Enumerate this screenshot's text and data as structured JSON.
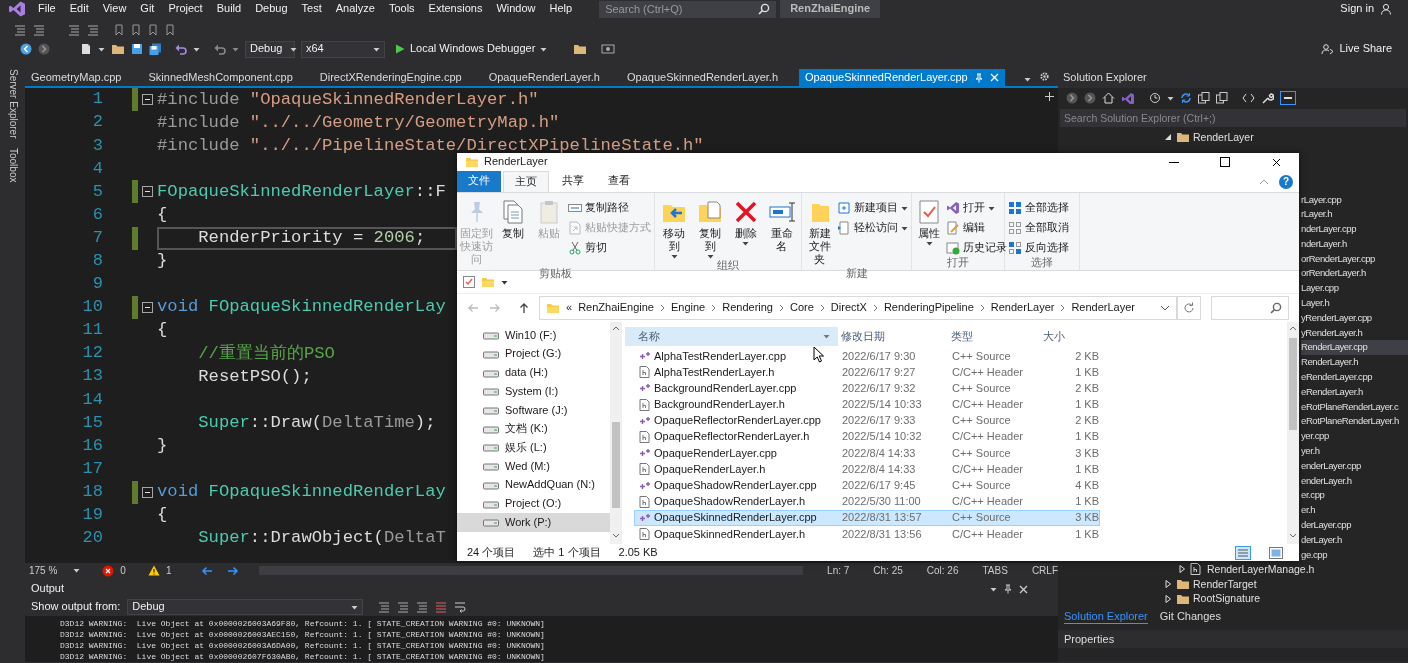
{
  "menu_bar": {
    "items": [
      "File",
      "Edit",
      "View",
      "Git",
      "Project",
      "Build",
      "Debug",
      "Test",
      "Analyze",
      "Tools",
      "Extensions",
      "Window",
      "Help"
    ],
    "search": {
      "placeholder": "Search (Ctrl+Q)"
    },
    "solution_name": "RenZhaiEngine",
    "sign_in": "Sign in"
  },
  "toolbar": {
    "configuration": "Debug",
    "platform": "x64",
    "start_debugger": "Local Windows Debugger",
    "live_share": "Live Share"
  },
  "side_tabs": [
    "Server Explorer",
    "Toolbox"
  ],
  "editor_tabs": [
    {
      "label": "GeometryMap.cpp",
      "selected": false
    },
    {
      "label": "SkinnedMeshComponent.cpp",
      "selected": false
    },
    {
      "label": "DirectXRenderingEngine.cpp",
      "selected": false
    },
    {
      "label": "OpaqueRenderLayer.h",
      "selected": false
    },
    {
      "label": "OpaqueSkinnedRenderLayer.h",
      "selected": false
    },
    {
      "label": "OpaqueSkinnedRenderLayer.cpp",
      "selected": true
    }
  ],
  "editor": {
    "lines": [
      {
        "number": "1",
        "changed": true,
        "foldable": true,
        "current": false,
        "tokens": [
          {
            "text": "#include ",
            "kind": "directive"
          },
          {
            "text": "\"OpaqueSkinnedRenderLayer.h\"",
            "kind": "string"
          }
        ]
      },
      {
        "number": "2",
        "changed": false,
        "foldable": false,
        "current": false,
        "tokens": [
          {
            "text": "#include ",
            "kind": "directive"
          },
          {
            "text": "\"../../Geometry/GeometryMap.h\"",
            "kind": "string"
          }
        ]
      },
      {
        "number": "3",
        "changed": false,
        "foldable": false,
        "current": false,
        "tokens": [
          {
            "text": "#include ",
            "kind": "directive"
          },
          {
            "text": "\"../../PipelineState/DirectXPipelineState.h\"",
            "kind": "string"
          }
        ]
      },
      {
        "number": "4",
        "changed": false,
        "foldable": false,
        "current": false
      },
      {
        "number": "5",
        "changed": true,
        "foldable": true,
        "current": false,
        "tokens": [
          {
            "text": "FOpaqueSkinnedRenderLayer",
            "kind": "type"
          },
          {
            "text": "::F",
            "kind": "plain"
          }
        ]
      },
      {
        "number": "6",
        "changed": false,
        "foldable": false,
        "current": false,
        "tokens": [
          {
            "text": "{",
            "kind": "plain"
          }
        ]
      },
      {
        "number": "7",
        "changed": true,
        "foldable": false,
        "current": true,
        "tokens": [
          {
            "text": "    RenderPriority = ",
            "kind": "plain"
          },
          {
            "text": "2006",
            "kind": "number"
          },
          {
            "text": ";",
            "kind": "plain"
          }
        ]
      },
      {
        "number": "8",
        "changed": false,
        "foldable": false,
        "current": false,
        "tokens": [
          {
            "text": "}",
            "kind": "plain"
          }
        ]
      },
      {
        "number": "9",
        "changed": false,
        "foldable": false,
        "current": false
      },
      {
        "number": "10",
        "changed": true,
        "foldable": true,
        "current": false,
        "tokens": [
          {
            "text": "void ",
            "kind": "keyword"
          },
          {
            "text": "FOpaqueSkinnedRenderLay",
            "kind": "type"
          }
        ]
      },
      {
        "number": "11",
        "changed": false,
        "foldable": false,
        "current": false,
        "tokens": [
          {
            "text": "{",
            "kind": "plain"
          }
        ]
      },
      {
        "number": "12",
        "changed": false,
        "foldable": false,
        "current": false,
        "tokens": [
          {
            "text": "    //重置当前的PSO",
            "kind": "comment"
          }
        ]
      },
      {
        "number": "13",
        "changed": false,
        "foldable": false,
        "current": false,
        "tokens": [
          {
            "text": "    ResetPSO();",
            "kind": "plain"
          }
        ]
      },
      {
        "number": "14",
        "changed": false,
        "foldable": false,
        "current": false
      },
      {
        "number": "15",
        "changed": false,
        "foldable": false,
        "current": false,
        "tokens": [
          {
            "text": "    Super",
            "kind": "type"
          },
          {
            "text": "::Draw(",
            "kind": "plain"
          },
          {
            "text": "DeltaTime",
            "kind": "param"
          },
          {
            "text": ");",
            "kind": "plain"
          }
        ]
      },
      {
        "number": "16",
        "changed": false,
        "foldable": false,
        "current": false,
        "tokens": [
          {
            "text": "}",
            "kind": "plain"
          }
        ]
      },
      {
        "number": "17",
        "changed": false,
        "foldable": false,
        "current": false
      },
      {
        "number": "18",
        "changed": true,
        "foldable": true,
        "current": false,
        "tokens": [
          {
            "text": "void ",
            "kind": "keyword"
          },
          {
            "text": "FOpaqueSkinnedRenderLay",
            "kind": "type"
          }
        ]
      },
      {
        "number": "19",
        "changed": false,
        "foldable": false,
        "current": false,
        "tokens": [
          {
            "text": "{",
            "kind": "plain"
          }
        ]
      },
      {
        "number": "20",
        "changed": false,
        "foldable": false,
        "current": false,
        "tokens": [
          {
            "text": "    Super",
            "kind": "type"
          },
          {
            "text": "::DrawObject(",
            "kind": "plain"
          },
          {
            "text": "DeltaT",
            "kind": "param"
          }
        ]
      }
    ]
  },
  "editor_status": {
    "zoom": "175 %",
    "errors": "0",
    "warnings": "1",
    "line": "Ln: 7",
    "char": "Ch: 25",
    "column": "Col: 26",
    "indent": "TABS",
    "line_ending": "CRLF"
  },
  "output": {
    "title": "Output",
    "source_label": "Show output from:",
    "source": "Debug",
    "lines": [
      "D3D12 WARNING:  Live Object at 0x0000026003A69F80, Refcount: 1. [ STATE_CREATION WARNING #0: UNKNOWN]",
      "D3D12 WARNING:  Live Object at 0x0000026003AEC150, Refcount: 1. [ STATE_CREATION WARNING #0: UNKNOWN]",
      "D3D12 WARNING:  Live Object at 0x0000026003A6DA00, Refcount: 1. [ STATE_CREATION WARNING #0: UNKNOWN]",
      "D3D12 WARNING:  Live Object at 0x000002607F630AB0, Refcount: 1. [ STATE_CREATION WARNING #0: UNKNOWN]"
    ]
  },
  "solution_explorer": {
    "title": "Solution Explorer",
    "search": {
      "placeholder": "Search Solution Explorer (Ctrl+;)"
    },
    "tree": [
      {
        "label": "RenderLayer",
        "kind": "folder",
        "expanded": true,
        "selected": false,
        "children": [
          {
            "label": "rLayer.cpp",
            "selected": false
          },
          {
            "label": "rLayer.h",
            "selected": false
          },
          {
            "label": "nderLayer.cpp",
            "selected": false
          },
          {
            "label": "nderLayer.h",
            "selected": false
          },
          {
            "label": "orRenderLayer.cpp",
            "selected": false
          },
          {
            "label": "orRenderLayer.h",
            "selected": false
          },
          {
            "label": "Layer.cpp",
            "selected": false
          },
          {
            "label": "Layer.h",
            "selected": false
          },
          {
            "label": "yRenderLayer.cpp",
            "selected": false
          },
          {
            "label": "yRenderLayer.h",
            "selected": false
          },
          {
            "label": "RenderLayer.cpp",
            "selected": true
          },
          {
            "label": "RenderLayer.h",
            "selected": false
          },
          {
            "label": "eRenderLayer.cpp",
            "selected": false
          },
          {
            "label": "eRenderLayer.h",
            "selected": false
          },
          {
            "label": "eRotPlaneRenderLayer.c",
            "selected": false
          },
          {
            "label": "eRotPlaneRenderLayer.h",
            "selected": false
          },
          {
            "label": "yer.cpp",
            "selected": false
          },
          {
            "label": "yer.h",
            "selected": false
          },
          {
            "label": "enderLayer.cpp",
            "selected": false
          },
          {
            "label": "enderLayer.h",
            "selected": false
          },
          {
            "label": "er.cpp",
            "selected": false
          },
          {
            "label": "er.h",
            "selected": false
          },
          {
            "label": "derLayer.cpp",
            "selected": false
          },
          {
            "label": "derLayer.h",
            "selected": false
          },
          {
            "label": "ge.cpp",
            "selected": false
          },
          {
            "label": "RenderLayerManage.h",
            "kind": "header",
            "expanded": false,
            "selected": false
          }
        ]
      },
      {
        "label": "RenderTarget",
        "kind": "folder",
        "expanded": false,
        "selected": false
      },
      {
        "label": "RootSignature",
        "kind": "folder",
        "expanded": false,
        "selected": false
      }
    ],
    "tabs": [
      {
        "label": "Solution Explorer",
        "selected": true
      },
      {
        "label": "Git Changes",
        "selected": false
      }
    ],
    "properties": "Properties"
  },
  "file_explorer": {
    "title": "RenderLayer",
    "ribbon_tabs": [
      {
        "label": "文件",
        "kind": "file",
        "selected": false
      },
      {
        "label": "主页",
        "kind": "page",
        "selected": true
      },
      {
        "label": "共享",
        "kind": "page",
        "selected": false
      },
      {
        "label": "查看",
        "kind": "page",
        "selected": false
      }
    ],
    "help": "?",
    "ribbon_groups": [
      {
        "label": "剪贴板",
        "commands": [
          {
            "label": "固定到快速访问",
            "kind": "large",
            "disabled": true,
            "menu": false
          },
          {
            "label": "复制",
            "kind": "large",
            "disabled": false,
            "menu": false
          },
          {
            "label": "粘贴",
            "kind": "large",
            "disabled": true,
            "menu": false
          },
          {
            "label": "复制路径",
            "kind": "small",
            "disabled": false,
            "menu": false
          },
          {
            "label": "粘贴快捷方式",
            "kind": "small",
            "disabled": true,
            "menu": false
          },
          {
            "label": "剪切",
            "kind": "small",
            "disabled": false,
            "menu": false
          }
        ]
      },
      {
        "label": "组织",
        "commands": [
          {
            "label": "移动到",
            "kind": "large",
            "disabled": false,
            "menu": true
          },
          {
            "label": "复制到",
            "kind": "large",
            "disabled": false,
            "menu": true
          },
          {
            "label": "删除",
            "kind": "large",
            "disabled": false,
            "menu": true
          },
          {
            "label": "重命名",
            "kind": "large",
            "disabled": false,
            "menu": false
          }
        ]
      },
      {
        "label": "新建",
        "commands": [
          {
            "label": "新建文件夹",
            "kind": "large",
            "disabled": false,
            "menu": false
          },
          {
            "label": "新建项目",
            "kind": "small",
            "disabled": false,
            "menu": true
          },
          {
            "label": "轻松访问",
            "kind": "small",
            "disabled": false,
            "menu": true
          }
        ]
      },
      {
        "label": "打开",
        "commands": [
          {
            "label": "属性",
            "kind": "large",
            "disabled": false,
            "menu": true
          },
          {
            "label": "打开",
            "kind": "small",
            "disabled": false,
            "menu": true
          },
          {
            "label": "编辑",
            "kind": "small",
            "disabled": false,
            "menu": false
          },
          {
            "label": "历史记录",
            "kind": "small",
            "disabled": false,
            "menu": false
          }
        ]
      },
      {
        "label": "选择",
        "commands": [
          {
            "label": "全部选择",
            "kind": "small",
            "disabled": false,
            "menu": false
          },
          {
            "label": "全部取消",
            "kind": "small",
            "disabled": false,
            "menu": false
          },
          {
            "label": "反向选择",
            "kind": "small",
            "disabled": false,
            "menu": false
          }
        ]
      }
    ],
    "address": {
      "overflow": "«",
      "crumbs": [
        "RenZhaiEngine",
        "Engine",
        "Rendering",
        "Core",
        "DirectX",
        "RenderingPipeline",
        "RenderLayer",
        "RenderLayer"
      ]
    },
    "drives": [
      {
        "label": "Win10 (F:)",
        "selected": false
      },
      {
        "label": "Project (G:)",
        "selected": false
      },
      {
        "label": "data (H:)",
        "selected": false
      },
      {
        "label": "System (I:)",
        "selected": false
      },
      {
        "label": "Software (J:)",
        "selected": false
      },
      {
        "label": "文档 (K:)",
        "selected": false
      },
      {
        "label": "娱乐 (L:)",
        "selected": false
      },
      {
        "label": "Wed (M:)",
        "selected": false
      },
      {
        "label": "NewAddQuan (N:)",
        "selected": false
      },
      {
        "label": "Project (O:)",
        "selected": false
      },
      {
        "label": "Work (P:)",
        "selected": true
      }
    ],
    "columns": [
      "名称",
      "修改日期",
      "类型",
      "大小"
    ],
    "files": [
      {
        "name": "AlphaTestRenderLayer.cpp",
        "modified": "2022/6/17 9:30",
        "type": "C++ Source",
        "size": "2 KB",
        "kind": "source",
        "selected": false
      },
      {
        "name": "AlphaTestRenderLayer.h",
        "modified": "2022/6/17 9:27",
        "type": "C/C++ Header",
        "size": "1 KB",
        "kind": "header",
        "selected": false
      },
      {
        "name": "BackgroundRenderLayer.cpp",
        "modified": "2022/6/17 9:32",
        "type": "C++ Source",
        "size": "2 KB",
        "kind": "source",
        "selected": false
      },
      {
        "name": "BackgroundRenderLayer.h",
        "modified": "2022/5/14 10:33",
        "type": "C/C++ Header",
        "size": "1 KB",
        "kind": "header",
        "selected": false
      },
      {
        "name": "OpaqueReflectorRenderLayer.cpp",
        "modified": "2022/6/17 9:33",
        "type": "C++ Source",
        "size": "2 KB",
        "kind": "source",
        "selected": false
      },
      {
        "name": "OpaqueReflectorRenderLayer.h",
        "modified": "2022/5/14 10:32",
        "type": "C/C++ Header",
        "size": "1 KB",
        "kind": "header",
        "selected": false
      },
      {
        "name": "OpaqueRenderLayer.cpp",
        "modified": "2022/8/4 14:33",
        "type": "C++ Source",
        "size": "3 KB",
        "kind": "source",
        "selected": false
      },
      {
        "name": "OpaqueRenderLayer.h",
        "modified": "2022/8/4 14:33",
        "type": "C/C++ Header",
        "size": "1 KB",
        "kind": "header",
        "selected": false
      },
      {
        "name": "OpaqueShadowRenderLayer.cpp",
        "modified": "2022/6/17 9:45",
        "type": "C++ Source",
        "size": "4 KB",
        "kind": "source",
        "selected": false
      },
      {
        "name": "OpaqueShadowRenderLayer.h",
        "modified": "2022/5/30 11:00",
        "type": "C/C++ Header",
        "size": "1 KB",
        "kind": "header",
        "selected": false
      },
      {
        "name": "OpaqueSkinnedRenderLayer.cpp",
        "modified": "2022/8/31 13:57",
        "type": "C++ Source",
        "size": "3 KB",
        "kind": "source",
        "selected": true
      },
      {
        "name": "OpaqueSkinnedRenderLayer.h",
        "modified": "2022/8/31 13:56",
        "type": "C/C++ Header",
        "size": "1 KB",
        "kind": "header",
        "selected": false
      }
    ],
    "status": {
      "count": "24 个项目",
      "selection": "选中 1 个项目",
      "selection_size": "2.05 KB"
    }
  }
}
